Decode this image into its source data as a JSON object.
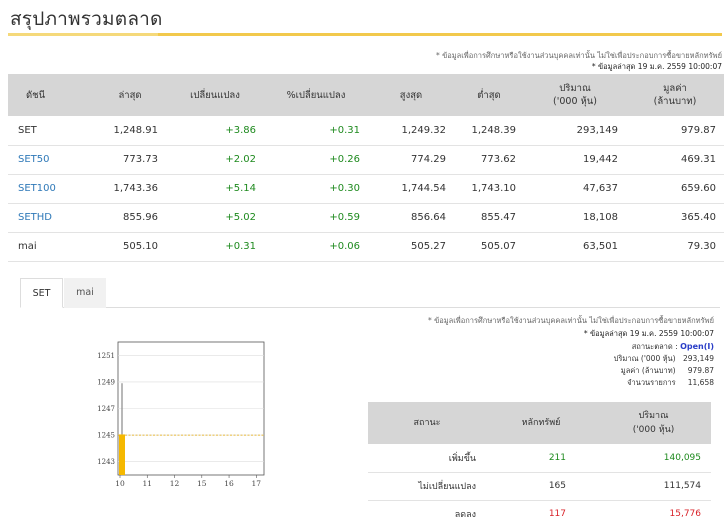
{
  "page": {
    "title": "สรุปภาพรวมตลาด"
  },
  "top_notes": {
    "disclaimer": "* ข้อมูลเพื่อการศึกษาหรือใช้งานส่วนบุคคลเท่านั้น ไม่ใช่เพื่อประกอบการซื้อขายหลักทรัพย์",
    "updated": "* ข้อมูลล่าสุด 19 ม.ค. 2559 10:00:07"
  },
  "index_table": {
    "headers": [
      "ดัชนี",
      "ล่าสุด",
      "เปลี่ยนแปลง",
      "%เปลี่ยนแปลง",
      "สูงสุด",
      "ต่ำสุด",
      "ปริมาณ\n('000 หุ้น)",
      "มูลค่า\n(ล้านบาท)"
    ],
    "header_line1": [
      "ดัชนี",
      "ล่าสุด",
      "เปลี่ยนแปลง",
      "%เปลี่ยนแปลง",
      "สูงสุด",
      "ต่ำสุด",
      "ปริมาณ",
      "มูลค่า"
    ],
    "header_line2": [
      "",
      "",
      "",
      "",
      "",
      "",
      "('000 หุ้น)",
      "(ล้านบาท)"
    ],
    "rows": [
      {
        "name": "SET",
        "link": false,
        "last": "1,248.91",
        "change": "+3.86",
        "pct": "+0.31",
        "high": "1,249.32",
        "low": "1,248.39",
        "volume": "293,149",
        "value": "979.87"
      },
      {
        "name": "SET50",
        "link": true,
        "last": "773.73",
        "change": "+2.02",
        "pct": "+0.26",
        "high": "774.29",
        "low": "773.62",
        "volume": "19,442",
        "value": "469.31"
      },
      {
        "name": "SET100",
        "link": true,
        "last": "1,743.36",
        "change": "+5.14",
        "pct": "+0.30",
        "high": "1,744.54",
        "low": "1,743.10",
        "volume": "47,637",
        "value": "659.60"
      },
      {
        "name": "SETHD",
        "link": true,
        "last": "855.96",
        "change": "+5.02",
        "pct": "+0.59",
        "high": "856.64",
        "low": "855.47",
        "volume": "18,108",
        "value": "365.40"
      },
      {
        "name": "mai",
        "link": false,
        "last": "505.10",
        "change": "+0.31",
        "pct": "+0.06",
        "high": "505.27",
        "low": "505.07",
        "volume": "63,501",
        "value": "79.30"
      }
    ]
  },
  "tabs": [
    {
      "label": "SET",
      "active": true
    },
    {
      "label": "mai",
      "active": false
    }
  ],
  "chart_data": {
    "type": "bar",
    "x_ticks": [
      "10",
      "11",
      "12",
      "15",
      "16",
      "17"
    ],
    "y_ticks": [
      "1251",
      "1249",
      "1247",
      "1245",
      "1243"
    ],
    "ylim": [
      1242,
      1252
    ],
    "reference_line": 1245,
    "bars": [
      {
        "x": "10",
        "open": 1245.05,
        "close": 1242,
        "high": 1248.9
      }
    ]
  },
  "right_notes": {
    "disclaimer": "* ข้อมูลเพื่อการศึกษาหรือใช้งานส่วนบุคคลเท่านั้น ไม่ใช่เพื่อประกอบการซื้อขายหลักทรัพย์",
    "updated": "* ข้อมูลล่าสุด 19 ม.ค. 2559 10:00:07"
  },
  "market_stats": {
    "status_label": "สถานะตลาด :",
    "status_value": "Open(I)",
    "volume_label": "ปริมาณ ('000 หุ้น)",
    "volume_value": "293,149",
    "value_label": "มูลค่า (ล้านบาท)",
    "value_value": "979.87",
    "trades_label": "จำนวนรายการ",
    "trades_value": "11,658"
  },
  "breadth_table": {
    "headers": [
      "สถานะ",
      "หลักทรัพย์",
      "ปริมาณ"
    ],
    "header_sub": [
      "",
      "",
      "('000 หุ้น)"
    ],
    "rows": [
      {
        "label": "เพิ่มขึ้น",
        "count": "211",
        "volume": "140,095",
        "color": "green"
      },
      {
        "label": "ไม่เปลี่ยนแปลง",
        "count": "165",
        "volume": "111,574",
        "color": "none"
      },
      {
        "label": "ลดลง",
        "count": "117",
        "volume": "15,776",
        "color": "red"
      }
    ]
  },
  "colors": {
    "accent": "#f2c94c",
    "up": "#1e8a1e",
    "down": "#d9232a",
    "link": "#2f79b8",
    "bar": "#f5b800"
  }
}
